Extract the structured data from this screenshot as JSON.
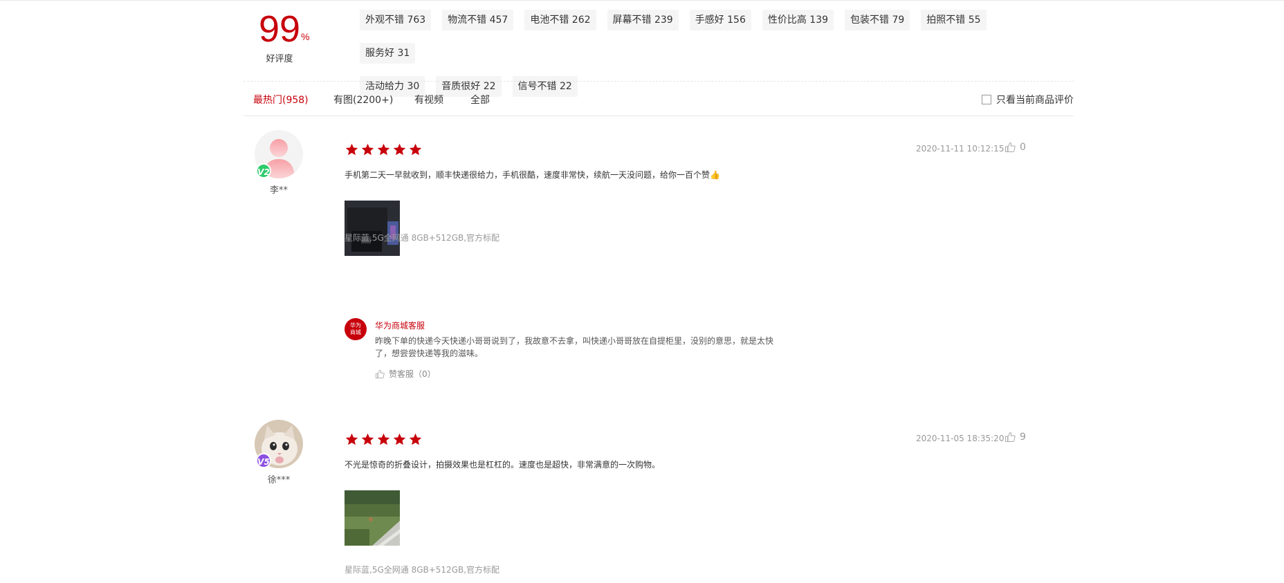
{
  "summary": {
    "score": "99",
    "percent_sign": "%",
    "score_label": "好评度",
    "tags": [
      "外观不错 763",
      "物流不错 457",
      "电池不错 262",
      "屏幕不错 239",
      "手感好 156",
      "性价比高 139",
      "包装不错 79",
      "拍照不错 55",
      "服务好 31",
      "活动给力 30",
      "音质很好 22",
      "信号不错 22"
    ]
  },
  "filters": {
    "tabs": [
      "最热门(958)",
      "有图(2200+)",
      "有视频",
      "全部"
    ],
    "active_index": 0,
    "only_current_label": "只看当前商品评价"
  },
  "reviews": [
    {
      "user": "李**",
      "level": "V2",
      "level_color": "#2ccb6b",
      "rating": 5,
      "time": "2020-11-11 10:12:15",
      "likes": "0",
      "text": "手机第二天一早就收到，顺丰快递很给力，手机很酷，速度非常快，续航一天没问题，给你一百个赞👍",
      "spec": "星际蓝,5G全网通 8GB+512GB,官方标配",
      "reply": {
        "logo_text": "华为商城",
        "name": "华为商城客服",
        "text": "昨晚下单的快递今天快递小哥哥说到了，我故意不去拿，叫快递小哥哥放在自提柜里，没别的意思，就是太快了，想尝尝快递等我的滋味。",
        "like_label": "赞客服（0）"
      }
    },
    {
      "user": "徐***",
      "level": "V5",
      "level_color": "#8c4fe0",
      "rating": 5,
      "time": "2020-11-05 18:35:20",
      "likes": "9",
      "text": "不光是惊奇的折叠设计，拍摄效果也是杠杠的。速度也是超快，非常满意的一次购物。",
      "spec": "星际蓝,5G全网通 8GB+512GB,官方标配"
    }
  ],
  "colors": {
    "accent": "#c7000b",
    "star": "#c7000b"
  }
}
